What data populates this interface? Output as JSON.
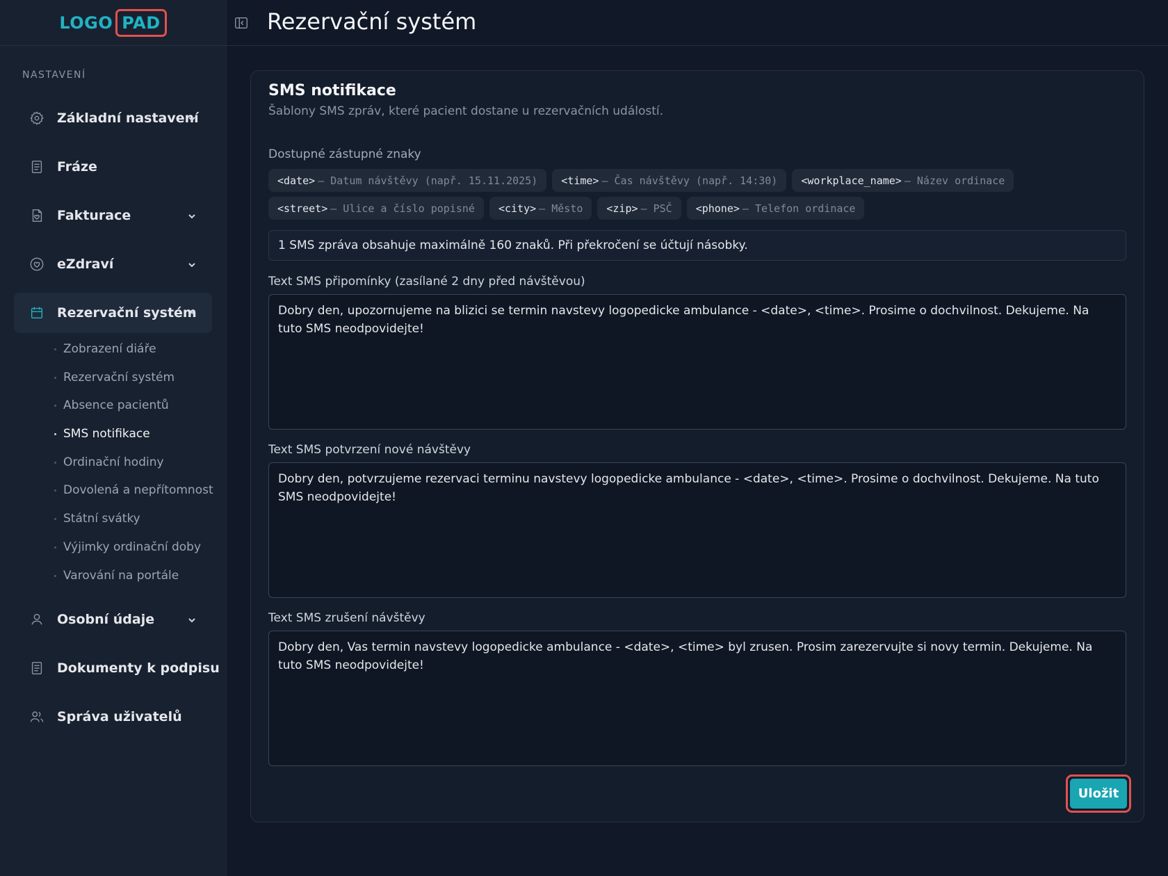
{
  "logo": {
    "left": "LOGO",
    "right": "PAD"
  },
  "header": {
    "title": "Rezervační systém"
  },
  "sidebar": {
    "section_label": "NASTAVENÍ",
    "items": [
      {
        "label": "Základní nastavení",
        "icon": "gear-icon"
      },
      {
        "label": "Fráze",
        "icon": "document-icon"
      },
      {
        "label": "Fakturace",
        "icon": "invoice-icon"
      },
      {
        "label": "eZdraví",
        "icon": "heart-icon"
      },
      {
        "label": "Rezervační systém",
        "icon": "calendar-icon"
      },
      {
        "label": "Osobní údaje",
        "icon": "user-icon"
      },
      {
        "label": "Dokumenty k podpisu",
        "icon": "document-icon"
      },
      {
        "label": "Správa uživatelů",
        "icon": "users-icon"
      }
    ],
    "sub_items": [
      "Zobrazení diáře",
      "Rezervační systém",
      "Absence pacientů",
      "SMS notifikace",
      "Ordinační hodiny",
      "Dovolená a nepřítomnost",
      "Státní svátky",
      "Výjimky ordinační doby",
      "Varování na portále"
    ]
  },
  "card": {
    "title": "SMS notifikace",
    "subtitle": "Šablony SMS zpráv, které pacient dostane u rezervačních událostí.",
    "placeholders_label": "Dostupné zástupné znaky",
    "chips": [
      {
        "code": "<date>",
        "desc": "– Datum návštěvy (např. 15.11.2025)"
      },
      {
        "code": "<time>",
        "desc": "– Čas návštěvy (např. 14:30)"
      },
      {
        "code": "<workplace_name>",
        "desc": "– Název ordinace"
      },
      {
        "code": "<street>",
        "desc": "– Ulice a číslo popisné"
      },
      {
        "code": "<city>",
        "desc": "– Město"
      },
      {
        "code": "<zip>",
        "desc": "– PSČ"
      },
      {
        "code": "<phone>",
        "desc": "– Telefon ordinace"
      }
    ],
    "info": "1 SMS zpráva obsahuje maximálně 160 znaků. Při překročení se účtují násobky.",
    "fields": [
      {
        "label": "Text SMS připomínky (zasílané 2 dny před návštěvou)",
        "value": "Dobry den, upozornujeme na blizici se termin navstevy logopedicke ambulance - <date>, <time>. Prosime o dochvilnost. Dekujeme. Na tuto SMS neodpovidejte!"
      },
      {
        "label": "Text SMS potvrzení nové návštěvy",
        "value": "Dobry den, potvrzujeme rezervaci terminu navstevy logopedicke ambulance - <date>, <time>. Prosime o dochvilnost. Dekujeme. Na tuto SMS neodpovidejte!"
      },
      {
        "label": "Text SMS zrušení návštěvy",
        "value": "Dobry den, Vas termin navstevy logopedicke ambulance - <date>, <time> byl zrusen. Prosim zarezervujte si novy termin. Dekujeme. Na tuto SMS neodpovidejte!"
      }
    ],
    "save_label": "Uložit"
  },
  "colors": {
    "accent": "#1aa5b3",
    "highlight": "#e0524f",
    "background": "#111827"
  }
}
